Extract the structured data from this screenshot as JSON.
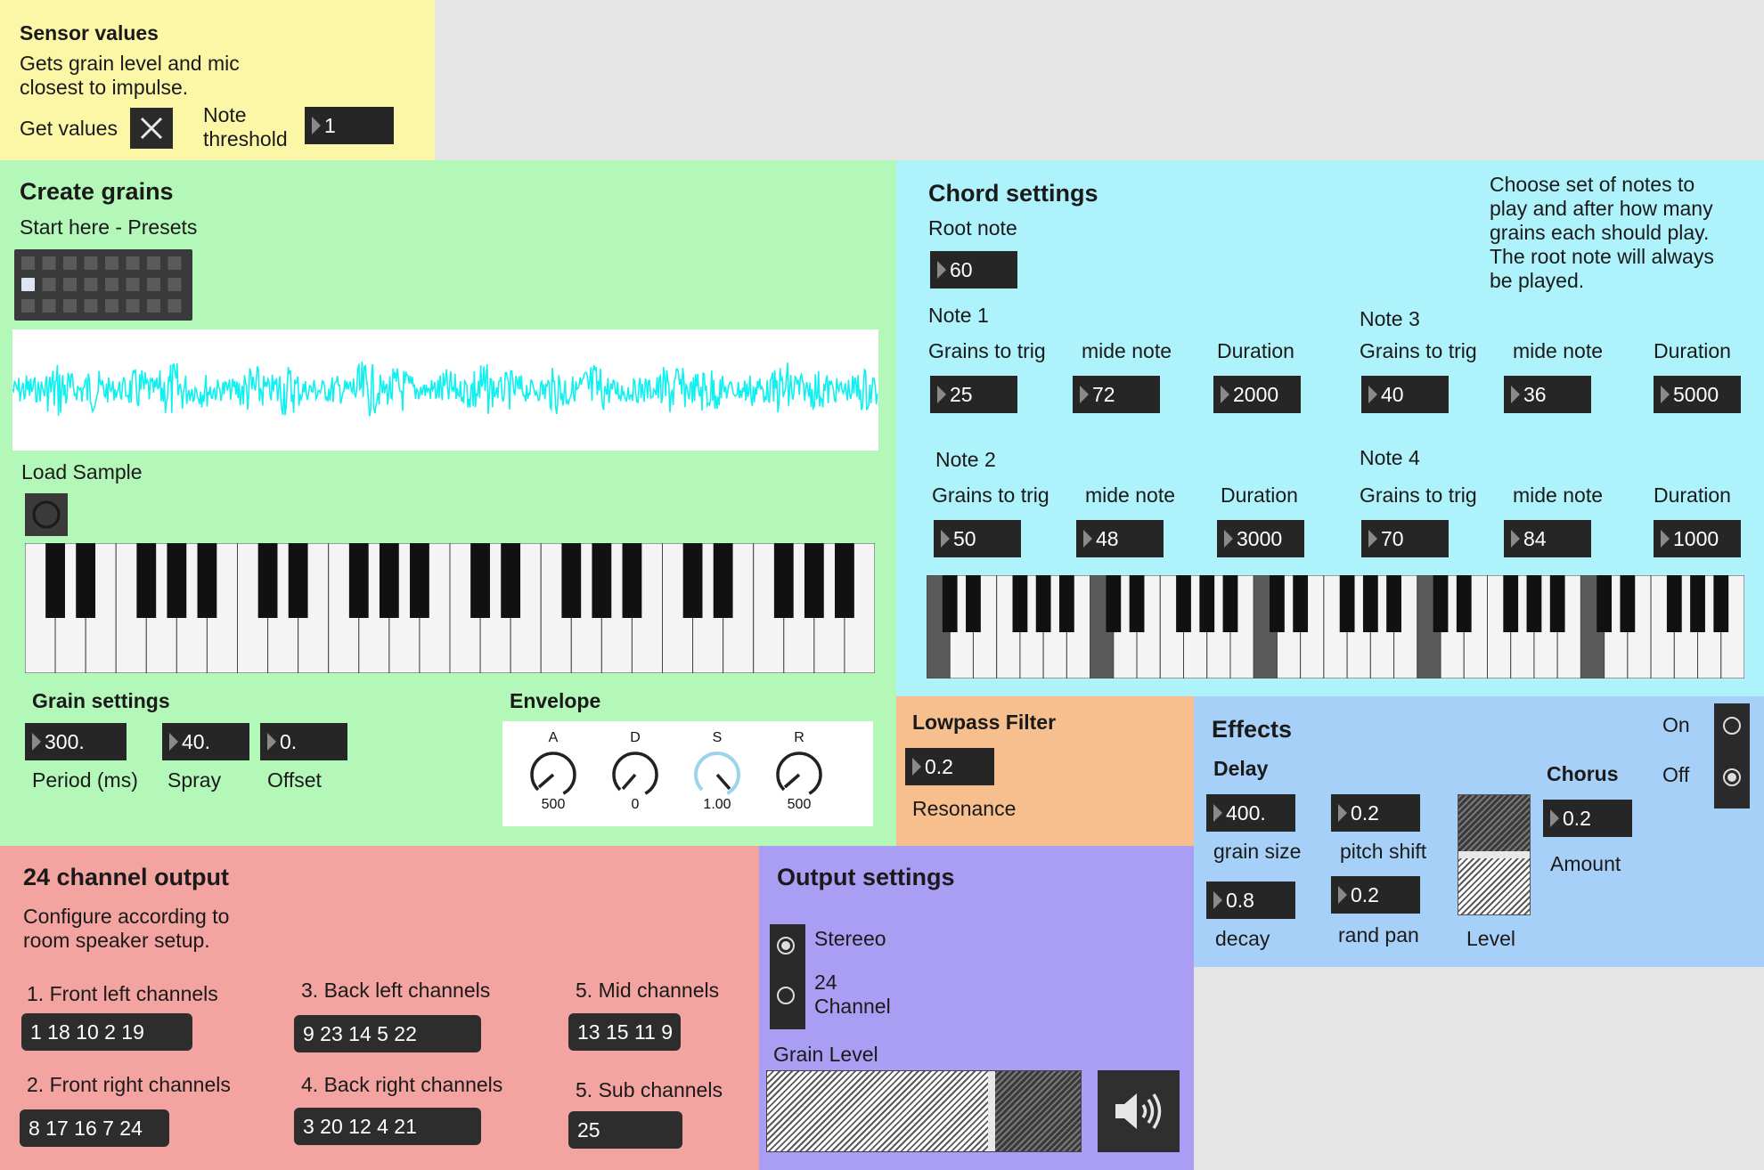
{
  "sensor": {
    "title": "Sensor values",
    "desc_line1": "Gets grain level and mic",
    "desc_line2": "closest to impulse.",
    "get_values_label": "Get values",
    "note_line1": "Note",
    "note_line2": "threshold",
    "threshold_value": "1"
  },
  "create": {
    "title": "Create grains",
    "presets_label": "Start here - Presets",
    "load_label": "Load Sample"
  },
  "grain": {
    "title": "Grain settings",
    "period": "300.",
    "spray": "40.",
    "offset": "0.",
    "period_label": "Period (ms)",
    "spray_label": "Spray",
    "offset_label": "Offset"
  },
  "envelope": {
    "title": "Envelope",
    "knobs": [
      {
        "label": "A",
        "value": "500"
      },
      {
        "label": "D",
        "value": "0"
      },
      {
        "label": "S",
        "value": "1.00"
      },
      {
        "label": "R",
        "value": "500"
      }
    ]
  },
  "chord": {
    "title": "Chord settings",
    "root_label": "Root note",
    "root_value": "60",
    "help_line1": "Choose set of notes to",
    "help_line2": "play and after how many",
    "help_line3": "grains each should play.",
    "help_line4": "The root note will always",
    "help_line5": "be played.",
    "col_grains": "Grains to trig",
    "col_note": "mide note",
    "col_duration": "Duration",
    "notes": [
      {
        "name": "Note 1",
        "grains": "25",
        "note": "72",
        "duration": "2000"
      },
      {
        "name": "Note 2",
        "grains": "50",
        "note": "48",
        "duration": "3000"
      },
      {
        "name": "Note 3",
        "grains": "40",
        "note": "36",
        "duration": "5000"
      },
      {
        "name": "Note 4",
        "grains": "70",
        "note": "84",
        "duration": "1000"
      }
    ]
  },
  "lowpass": {
    "title": "Lowpass Filter",
    "value": "0.2",
    "resonance_label": "Resonance"
  },
  "effects": {
    "title": "Effects",
    "delay_title": "Delay",
    "grain_size": "400.",
    "grain_size_label": "grain size",
    "pitch_shift": "0.2",
    "pitch_shift_label": "pitch shift",
    "decay": "0.8",
    "decay_label": "decay",
    "rand_pan": "0.2",
    "rand_pan_label": "rand pan",
    "level_label": "Level",
    "level_fraction": 0.5,
    "chorus_title": "Chorus",
    "chorus_amount": "0.2",
    "amount_label": "Amount",
    "on_label": "On",
    "off_label": "Off",
    "selected": "Off"
  },
  "channels": {
    "title": "24 channel output",
    "desc_line1": "Configure according to",
    "desc_line2": "room speaker setup.",
    "groups": [
      {
        "label": "1. Front left channels",
        "value": "1 18 10 2 19"
      },
      {
        "label": "3. Back left channels",
        "value": "9 23 14 5 22"
      },
      {
        "label": "5. Mid channels",
        "value": "13 15 11 9"
      },
      {
        "label": "2. Front right channels",
        "value": "8 17 16 7 24"
      },
      {
        "label": "4. Back right channels",
        "value": "3 20 12 4 21"
      },
      {
        "label": "5. Sub channels",
        "value": "25"
      }
    ]
  },
  "output": {
    "title": "Output settings",
    "stereo_label": "Stereeo",
    "ch24_line1": "24",
    "ch24_line2": "Channel",
    "selected": "Stereeo",
    "grain_level_label": "Grain Level",
    "grain_level_fraction": 0.72
  },
  "colors": {
    "sensor_bg": "#fbf7a6",
    "create_bg": "#b3f8b8",
    "chord_bg": "#aef2fb",
    "lowpass_bg": "#f6bf8d",
    "effects_bg": "#a7d0f8",
    "channels_bg": "#f3a3a0",
    "output_bg": "#a99ef4",
    "waveform": "#10f0f0"
  }
}
